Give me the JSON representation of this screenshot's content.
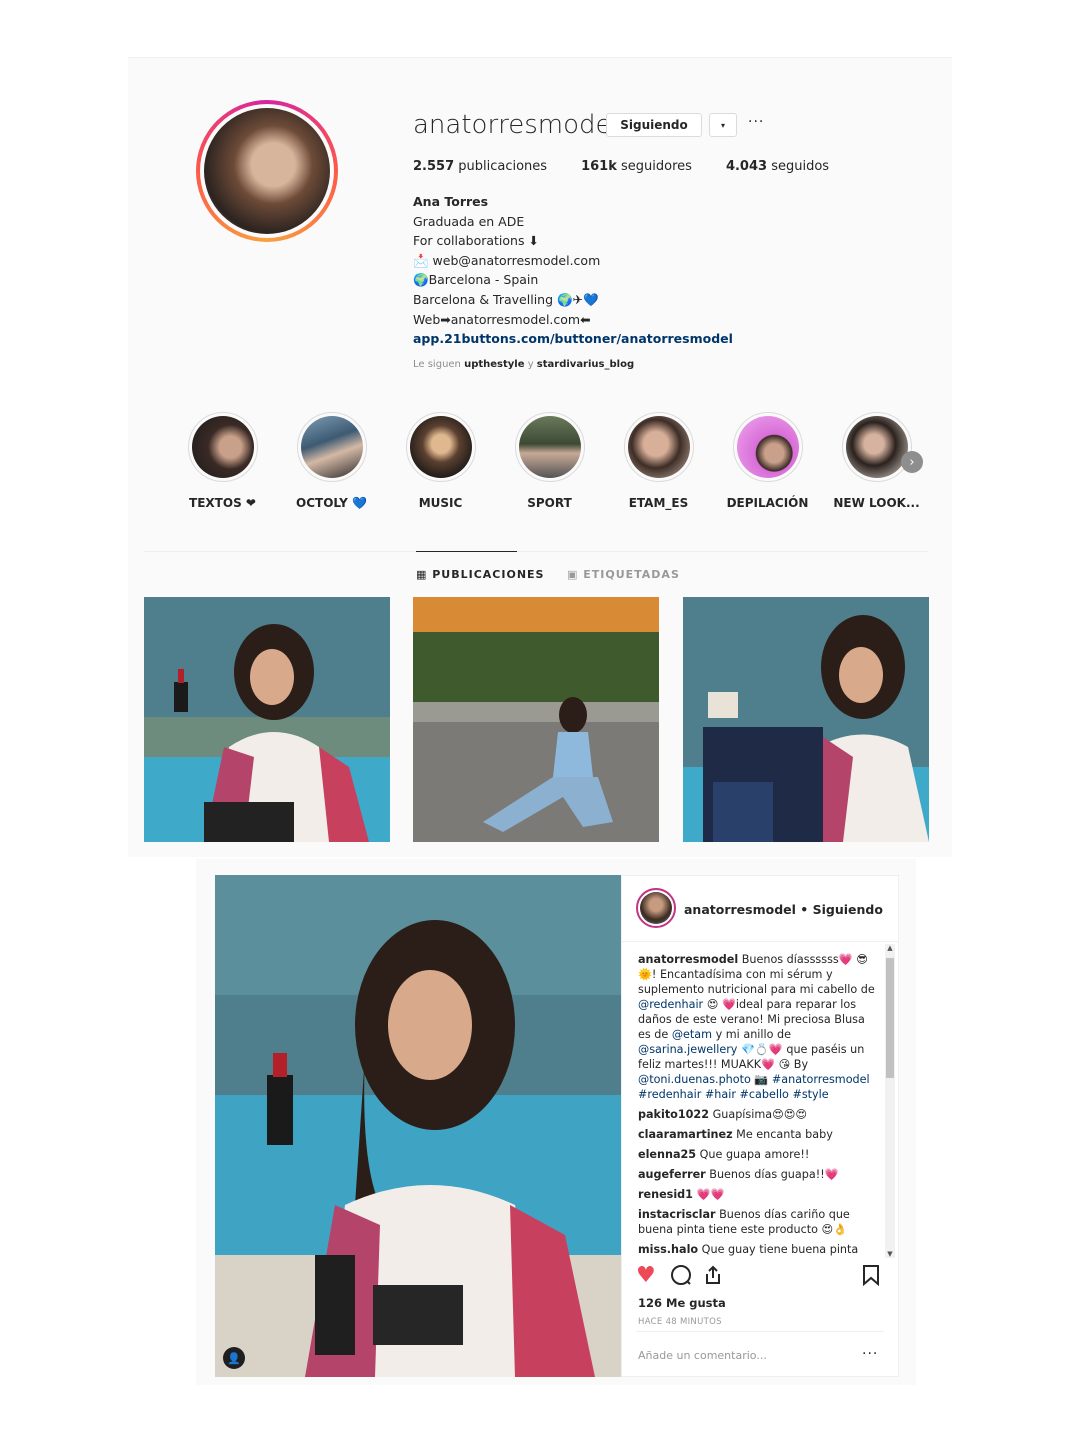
{
  "profile": {
    "username": "anatorresmodel",
    "follow_button": "Siguiendo",
    "caret_icon": "▾",
    "more_icon": "···",
    "stats": {
      "posts": "2.557",
      "posts_label": "publicaciones",
      "followers": "161k",
      "followers_label": "seguidores",
      "following": "4.043",
      "following_label": "seguidos"
    },
    "bio": {
      "name": "Ana Torres",
      "line1": "Graduada en ADE",
      "line2": "For collaborations ⬇",
      "line3": "📩 web@anatorresmodel.com",
      "line4": "🌍Barcelona - Spain",
      "line5": "Barcelona & Travelling 🌍✈💙",
      "line6": "Web➡anatorresmodel.com⬅",
      "link": "app.21buttons.com/buttoner/anatorresmodel",
      "followed_prefix": "Le siguen",
      "followed_user1": "upthestyle",
      "followed_and": "y",
      "followed_user2": "stardivarius_blog"
    },
    "highlights": [
      {
        "label": "TEXTOS ❤"
      },
      {
        "label": "OCTOLY 💙"
      },
      {
        "label": "MUSIC"
      },
      {
        "label": "SPORT"
      },
      {
        "label": "ETAM_ES"
      },
      {
        "label": "DEPILACIÓN"
      },
      {
        "label": "NEW LOOK..."
      }
    ],
    "next_icon": "›",
    "tabs": {
      "posts": "PUBLICACIONES",
      "tagged": "ETIQUETADAS"
    }
  },
  "post": {
    "header_user": "anatorresmodel",
    "header_sep": " • ",
    "header_status": "Siguiendo",
    "caption_user": "anatorresmodel",
    "caption_part1": "Buenos díassssss💗 😎 🌞! Encantadísima con mi sérum y suplemento nutricional para mi cabello de",
    "caption_mention1": "@redenhair",
    "caption_part2": "😍 💗ideal para reparar los daños de este verano! Mi preciosa Blusa es de",
    "caption_mention2": "@etam",
    "caption_part3": "y mi anillo de",
    "caption_mention3": "@sarina.jewellery",
    "caption_part4": "💎💍💗 que paséis un feliz martes!!! MUAKK💗 😘 By",
    "caption_mention4": "@toni.duenas.photo",
    "caption_part5": "📷",
    "caption_tags": "#anatorresmodel #redenhair #hair #cabello #style",
    "comments": [
      {
        "user": "pakito1022",
        "text": "Guapísima😍😍😍"
      },
      {
        "user": "claaramartinez",
        "text": "Me encanta baby"
      },
      {
        "user": "elenna25",
        "text": "Que guapa amore!!"
      },
      {
        "user": "augeferrer",
        "text": "Buenos días guapa!!💗"
      },
      {
        "user": "renesid1",
        "text": "💗💗"
      },
      {
        "user": "instacrisclar",
        "text": "Buenos días cariño que buena pinta tiene este producto 😍👌"
      },
      {
        "user": "miss.halo",
        "text": "Que guay tiene buena pinta"
      }
    ],
    "likes": "126 Me gusta",
    "time": "HACE 48 MINUTOS",
    "comment_placeholder": "Añade un comentario...",
    "more_icon": "···",
    "tag_icon": "👤"
  },
  "colors": {
    "like_red": "#ed4956",
    "link_blue": "#003569",
    "story_gradient": "#d6249f"
  }
}
